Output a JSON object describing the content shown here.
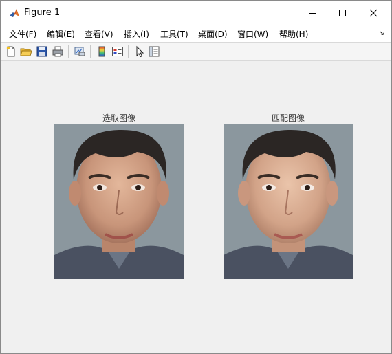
{
  "window": {
    "title": "Figure 1",
    "app_icon": "matlab-icon",
    "controls": [
      "minimize-icon",
      "maximize-icon",
      "close-icon"
    ]
  },
  "menu": {
    "items": [
      {
        "label": "文件(F)"
      },
      {
        "label": "编辑(E)"
      },
      {
        "label": "查看(V)"
      },
      {
        "label": "插入(I)"
      },
      {
        "label": "工具(T)"
      },
      {
        "label": "桌面(D)"
      },
      {
        "label": "窗口(W)"
      },
      {
        "label": "帮助(H)"
      }
    ],
    "overflow_icon": "menu-overflow-arrow-icon"
  },
  "toolbar": {
    "icons": [
      "new-figure-icon",
      "open-file-icon",
      "save-icon",
      "print-icon",
      "link-plot-icon",
      "insert-colorbar-icon",
      "insert-legend-icon",
      "edit-plot-pointer-icon",
      "property-inspector-icon"
    ]
  },
  "axes": [
    {
      "title": "选取图像",
      "image": "face photo (selected image)"
    },
    {
      "title": "匹配图像",
      "image": "face photo (matched image)"
    }
  ],
  "colors": {
    "figure_background": "#f0f0f0",
    "titlebar_background": "#ffffff",
    "photo_background": "#8b979e"
  }
}
